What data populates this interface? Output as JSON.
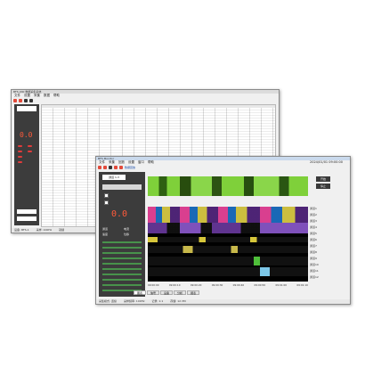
{
  "back_window": {
    "title": "BFS-200 数据采集系统",
    "menu": [
      "文件",
      "设置",
      "采集",
      "数据",
      "帮助"
    ],
    "big_value": "0.0",
    "status": [
      "设备: BFS-1",
      "采样: 100Hz",
      "就绪"
    ]
  },
  "front_window": {
    "title": "BFS-Monitor",
    "menu": [
      "文件",
      "采集",
      "回放",
      "设置",
      "窗口",
      "帮助"
    ],
    "toolbar_label": "数据回放",
    "top_right": "2024/01/01 09:00:00",
    "channel_box": "通道 1-3",
    "big_value": "0.0",
    "side_labels": [
      "通道",
      "电流",
      "速度",
      "位移"
    ],
    "right_buttons": [
      "开始",
      "停止"
    ],
    "legend": [
      "通道1",
      "通道2",
      "通道3",
      "通道4",
      "通道5",
      "通道6",
      "通道7",
      "通道8",
      "通道9",
      "通道10",
      "通道11",
      "通道12"
    ],
    "tabs": [
      "图表",
      "信号",
      "设备",
      "分析",
      "报表"
    ],
    "status": [
      "采集模式: 连续",
      "采样频率: 100Hz",
      "记录: 1:1",
      "存储: 12.3M"
    ],
    "time_ticks": [
      "09:00:00",
      "09:00:10",
      "09:00:20",
      "09:00:30",
      "09:00:40",
      "09:00:50",
      "09:01:00",
      "09:01:10"
    ]
  }
}
